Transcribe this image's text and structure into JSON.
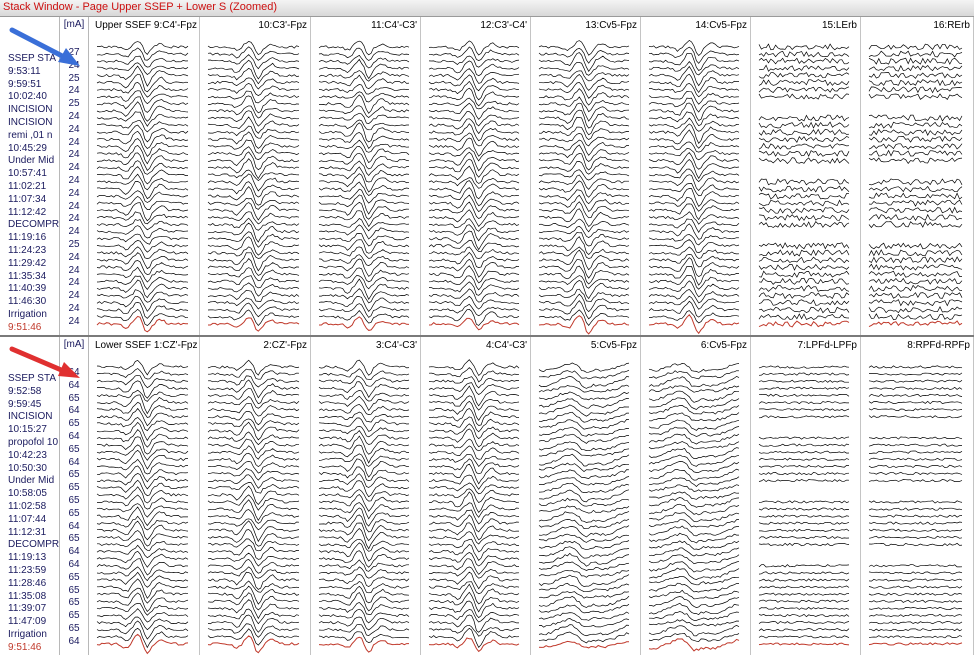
{
  "window": {
    "title": "Stack Window - Page Upper SSEP + Lower S (Zoomed)"
  },
  "colors": {
    "trace": "#000000",
    "latest_trace": "#c0392b",
    "event_text": "#1a1a5e",
    "latest_event": "#c0392b",
    "arrow_upper": "#3a6fd8",
    "arrow_lower": "#e03030"
  },
  "upper": {
    "ma_header": "[mA]",
    "events": [
      "SSEP STA",
      "9:53:11",
      "9:59:51",
      "10:02:40",
      "INCISION",
      "INCISION",
      "remi ,01 n",
      "10:45:29",
      "Under Mid",
      "10:57:41",
      "11:02:21",
      "11:07:34",
      "11:12:42",
      "DECOMPR",
      "11:19:16",
      "11:24:23",
      "11:29:42",
      "11:35:34",
      "11:40:39",
      "11:46:30",
      "Irrigation",
      "9:51:46"
    ],
    "ma_values": [
      "27",
      "24",
      "25",
      "24",
      "25",
      "24",
      "24",
      "24",
      "24",
      "24",
      "24",
      "24",
      "24",
      "24",
      "24",
      "25",
      "24",
      "24",
      "24",
      "24",
      "24",
      "24"
    ],
    "channels": [
      "Upper SSEF 9:C4'-Fpz",
      "10:C3'-Fpz",
      "11:C4'-C3'",
      "12:C3'-C4'",
      "13:Cv5-Fpz",
      "14:Cv5-Fpz",
      "15:LErb",
      "16:RErb"
    ]
  },
  "lower": {
    "ma_header": "[mA]",
    "events": [
      "SSEP STA",
      "9:52:58",
      "9:59:45",
      "INCISION",
      "10:15:27",
      "propofol 10",
      "10:42:23",
      "10:50:30",
      "Under Mid",
      "10:58:05",
      "11:02:58",
      "11:07:44",
      "11:12:31",
      "DECOMPR",
      "11:19:13",
      "11:23:59",
      "11:28:46",
      "11:35:08",
      "11:39:07",
      "11:47:09",
      "Irrigation",
      "9:51:46"
    ],
    "ma_values": [
      "64",
      "64",
      "65",
      "64",
      "65",
      "64",
      "65",
      "64",
      "65",
      "65",
      "65",
      "65",
      "64",
      "65",
      "64",
      "64",
      "65",
      "65",
      "65",
      "65",
      "65",
      "64"
    ],
    "channels": [
      "Lower SSEF 1:CZ'-Fpz",
      "2:CZ'-Fpz",
      "3:C4'-C3'",
      "4:C4'-C3'",
      "5:Cv5-Fpz",
      "6:Cv5-Fpz",
      "7:LPFd-LPFp",
      "8:RPFd-RPFp"
    ]
  }
}
